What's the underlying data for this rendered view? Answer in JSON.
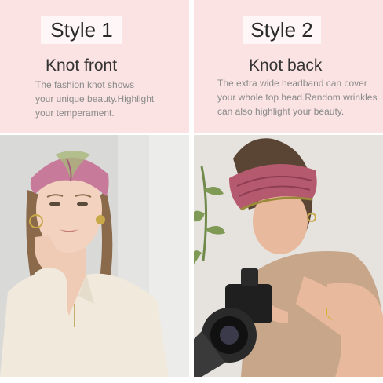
{
  "left": {
    "style_label": "Style 1",
    "title": "Knot front",
    "desc_lines": [
      "The fashion knot shows",
      "your unique beauty.Highlight",
      "your temperament."
    ]
  },
  "right": {
    "style_label": "Style 2",
    "title": "Knot back",
    "desc_lines": [
      "The extra wide headband can cover",
      "your whole top head.Random wrinkles",
      "can also highlight your beauty."
    ]
  },
  "colors": {
    "panel_bg": "#fbe3e3",
    "headband_left": "#c77a9a",
    "headband_right": "#b5596f"
  }
}
